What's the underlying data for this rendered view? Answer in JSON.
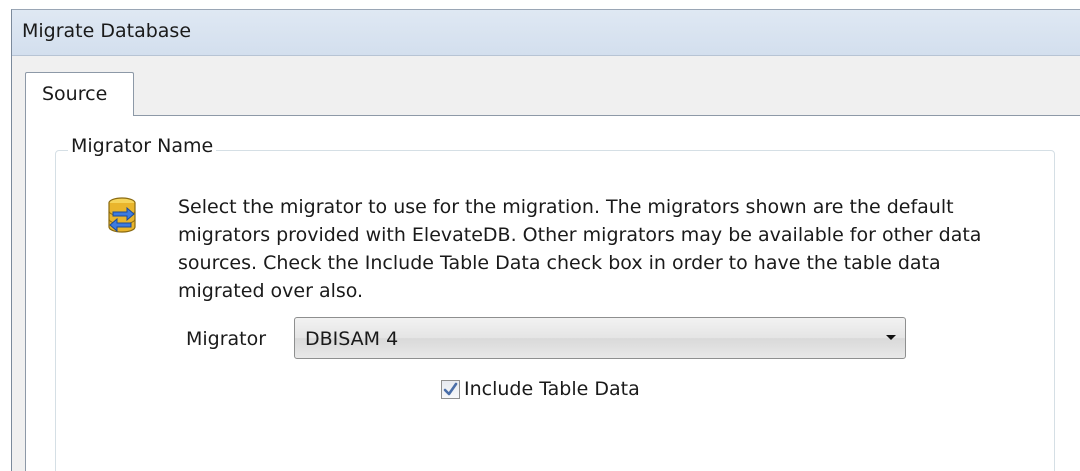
{
  "window": {
    "title": "Migrate Database"
  },
  "tabs": [
    {
      "label": "Source",
      "active": true
    }
  ],
  "group": {
    "legend": "Migrator Name",
    "icon": "database-migration-icon",
    "description": "Select the migrator to use for the migration.  The migrators shown are the default migrators provided with ElevateDB.  Other migrators may be available for other data sources.  Check the Include Table Data check box in order to have the table data migrated over also."
  },
  "migrator": {
    "label": "Migrator",
    "selected": "DBISAM 4"
  },
  "include_table_data": {
    "label": "Include Table Data",
    "checked": true
  },
  "colors": {
    "titlebar": "#d3dfee",
    "accent_check": "#4a6ea8"
  }
}
